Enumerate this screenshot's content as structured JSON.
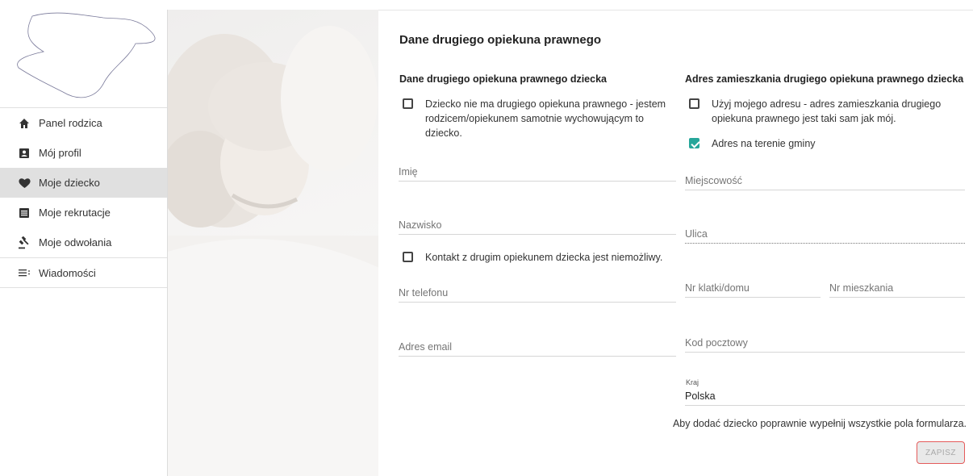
{
  "sidebar": {
    "items": [
      {
        "label": "Panel rodzica",
        "icon": "home-icon"
      },
      {
        "label": "Mój profil",
        "icon": "profile-card-icon"
      },
      {
        "label": "Moje dziecko",
        "icon": "heart-icon",
        "active": true
      },
      {
        "label": "Moje rekrutacje",
        "icon": "document-list-icon"
      },
      {
        "label": "Moje odwołania",
        "icon": "gavel-icon"
      },
      {
        "label": "Wiadomości",
        "icon": "messages-icon"
      }
    ]
  },
  "page": {
    "title": "Dane drugiego opiekuna prawnego"
  },
  "left_section": {
    "title": "Dane drugiego opiekuna prawnego dziecka",
    "no_guardian_label": "Dziecko nie ma drugiego opiekuna prawnego - jestem rodzicem/opiekunem samotnie wychowującym to dziecko.",
    "first_name_placeholder": "Imię",
    "last_name_placeholder": "Nazwisko",
    "contact_impossible_label": "Kontakt z drugim opiekunem dziecka jest niemożliwy.",
    "phone_placeholder": "Nr telefonu",
    "email_placeholder": "Adres email"
  },
  "right_section": {
    "title": "Adres zamieszkania drugiego opiekuna prawnego dziecka",
    "use_my_address_label": "Użyj mojego adresu - adres zamieszkania drugiego opiekuna prawnego jest taki sam jak mój.",
    "in_municipality_label": "Adres na terenie gminy",
    "city_placeholder": "Miejscowość",
    "street_placeholder": "Ulica",
    "building_placeholder": "Nr klatki/domu",
    "apartment_placeholder": "Nr mieszkania",
    "postal_placeholder": "Kod pocztowy",
    "country_label": "Kraj",
    "country_value": "Polska"
  },
  "footer": {
    "notice": "Aby dodać dziecko poprawnie wypełnij wszystkie pola formularza.",
    "save_label": "ZAPISZ"
  },
  "colors": {
    "checkbox_checked": "#26a69a",
    "save_border": "#e45b5b",
    "active_nav": "#e0e0e0"
  }
}
